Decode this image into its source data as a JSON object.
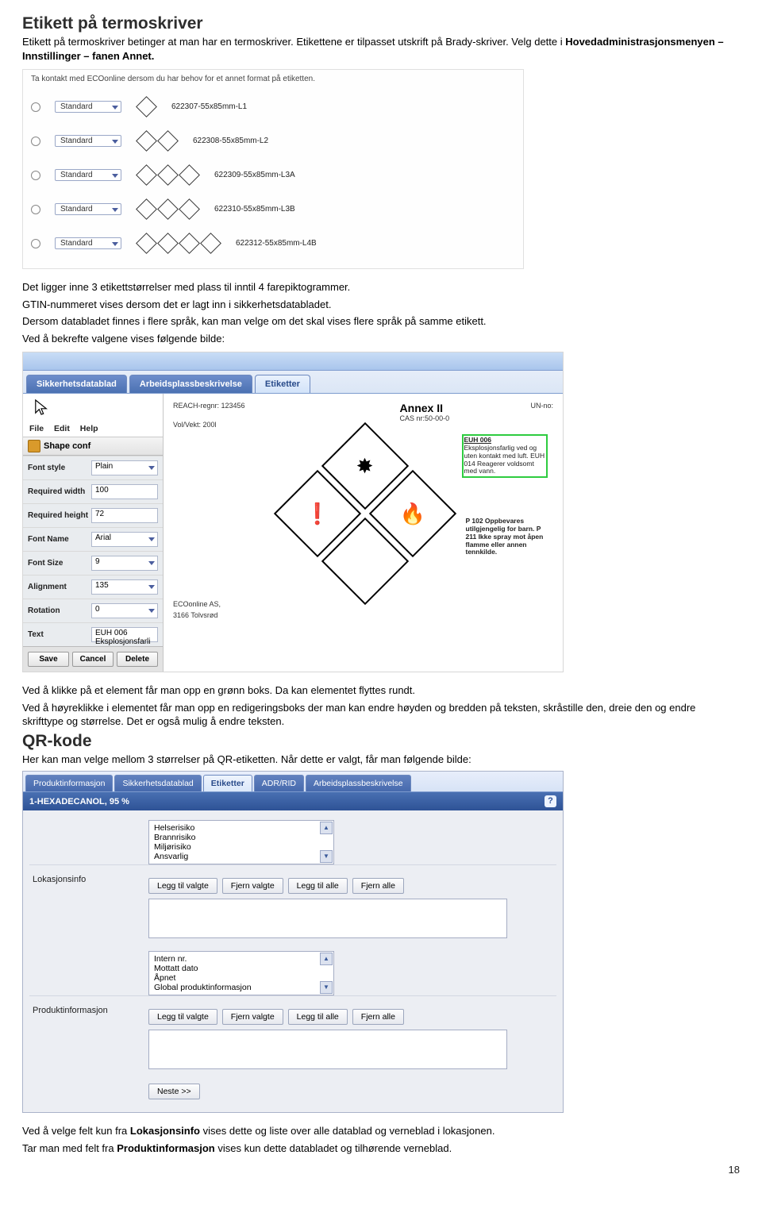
{
  "doc": {
    "h1": "Etikett på termoskriver",
    "p1a": "Etikett på termoskriver betinger at man har en termoskriver. Etikettene er tilpasset utskrift på Brady-skriver. Velg dette i ",
    "p1b": "Hovedadministrasjonsmenyen – Innstillinger – fanen Annet.",
    "fig1_header": "Ta kontakt med ECOonline dersom du har behov for et annet format på etiketten.",
    "ddStandard": "Standard",
    "rows": [
      {
        "code": "622307-55x85mm-L1",
        "diamonds": 1
      },
      {
        "code": "622308-55x85mm-L2",
        "diamonds": 2
      },
      {
        "code": "622309-55x85mm-L3A",
        "diamonds": 3
      },
      {
        "code": "622310-55x85mm-L3B",
        "diamonds": 3
      },
      {
        "code": "622312-55x85mm-L4B",
        "diamonds": 4
      }
    ],
    "p2": "Det ligger inne 3 etikettstørrelser med plass til inntil 4 farepiktogrammer.",
    "p3": "GTIN-nummeret vises dersom det er lagt inn i sikkerhetsdatabladet.",
    "p4": "Dersom databladet finnes i flere språk, kan man velge om det skal vises flere språk på samme etikett.",
    "p5": "Ved å bekrefte valgene vises følgende bilde:",
    "tabs2": [
      "Sikkerhetsdatablad",
      "Arbeidsplassbeskrivelse",
      "Etiketter"
    ],
    "menu2": [
      "File",
      "Edit",
      "Help"
    ],
    "shapeTitle": "Shape conf",
    "shape": [
      {
        "lbl": "Font style",
        "val": "Plain",
        "dd": true
      },
      {
        "lbl": "Required width",
        "val": "100",
        "dd": false
      },
      {
        "lbl": "Required height",
        "val": "72",
        "dd": false
      },
      {
        "lbl": "Font Name",
        "val": "Arial",
        "dd": true
      },
      {
        "lbl": "Font Size",
        "val": "9",
        "dd": true
      },
      {
        "lbl": "Alignment",
        "val": "135",
        "dd": true
      },
      {
        "lbl": "Rotation",
        "val": "0",
        "dd": true
      },
      {
        "lbl": "Text",
        "val": "EUH 006 Eksplosjonsfarli",
        "dd": false
      }
    ],
    "shapeBtns": [
      "Save",
      "Cancel",
      "Delete"
    ],
    "canvas": {
      "reach": "REACH-regnr: 123456",
      "vol": "Vol/Vekt: 200l",
      "annex": "Annex II",
      "cas": "CAS nr:50-00-0",
      "un": "UN-no:",
      "euh006_title": "EUH 006",
      "euh006": "Eksplosjonsfarlig ved og uten kontakt med luft. EUH 014 Reagerer voldsomt med vann.",
      "p102": "P 102 Oppbevares utilgjengelig for barn. P 211 Ikke spray mot åpen flamme eller annen tennkilde.",
      "company1": "ECOonline AS,",
      "company2": "3166 Tolvsrød"
    },
    "p6": "Ved å klikke på et element får man opp en grønn boks. Da kan elementet flyttes rundt.",
    "p7": "Ved å høyreklikke i elementet får man opp en redigeringsboks der man kan endre høyden og bredden på teksten, skråstille den, dreie den og endre skrifttype og størrelse. Det er også mulig å endre teksten.",
    "h2": "QR-kode",
    "p8": "Her kan man velge mellom 3 størrelser på QR-etiketten. Når dette er valgt, får man følgende bilde:",
    "tabs3": [
      "Produktinformasjon",
      "Sikkerhetsdatablad",
      "Etiketter",
      "ADR/RID",
      "Arbeidsplassbeskrivelse"
    ],
    "barTitle": "1-HEXADECANOL, 95 %",
    "list1": [
      "Helserisiko",
      "Brannrisiko",
      "Miljørisiko",
      "Ansvarlig"
    ],
    "sect1": "Lokasjonsinfo",
    "btns1": [
      "Legg til valgte",
      "Fjern valgte",
      "Legg til alle",
      "Fjern alle"
    ],
    "list2": [
      "Intern nr.",
      "Mottatt dato",
      "Åpnet",
      "Global produktinformasjon"
    ],
    "sect2": "Produktinformasjon",
    "btns2": [
      "Legg til valgte",
      "Fjern valgte",
      "Legg til alle",
      "Fjern alle"
    ],
    "next": "Neste >>",
    "p9a": "Ved å velge felt kun fra ",
    "p9b": "Lokasjonsinfo",
    "p9c": " vises dette og liste over alle datablad og verneblad i lokasjonen.",
    "p10a": "Tar man med felt fra ",
    "p10b": "Produktinformasjon",
    "p10c": " vises kun dette databladet og tilhørende verneblad.",
    "pagenum": "18"
  }
}
